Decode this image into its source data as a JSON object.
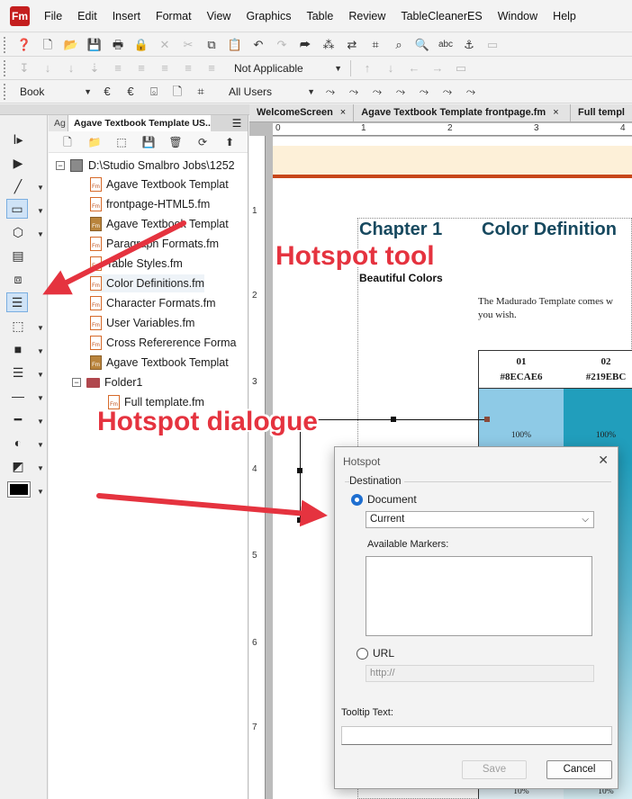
{
  "app": {
    "logo": "Fm",
    "menu": [
      "File",
      "Edit",
      "Insert",
      "Format",
      "View",
      "Graphics",
      "Table",
      "Review",
      "TableCleanerES",
      "Window",
      "Help"
    ]
  },
  "toolbar": {
    "condition_combo": "Not Applicable",
    "book_combo": "Book",
    "users_combo": "All Users"
  },
  "book_panel": {
    "tab_small": "Ag",
    "tab_title": "Agave Textbook Template US...",
    "menu_icon": "hamburger-icon",
    "tree": [
      {
        "label": "D:\\Studio Smalbro Jobs\\1252",
        "type": "root"
      },
      {
        "label": "Agave Textbook Templat",
        "type": "file"
      },
      {
        "label": "frontpage-HTML5.fm",
        "type": "file"
      },
      {
        "label": "Agave Textbook Templat",
        "type": "book"
      },
      {
        "label": "Paragraph Formats.fm",
        "type": "file"
      },
      {
        "label": "Table Styles.fm",
        "type": "file"
      },
      {
        "label": "Color Definitions.fm",
        "type": "file"
      },
      {
        "label": "Character Formats.fm",
        "type": "file"
      },
      {
        "label": "User Variables.fm",
        "type": "file"
      },
      {
        "label": "Cross Refererence Forma",
        "type": "file"
      },
      {
        "label": "Agave Textbook Templat",
        "type": "book"
      },
      {
        "label": "Folder1",
        "type": "folder"
      },
      {
        "label": "Full template.fm",
        "type": "file"
      }
    ]
  },
  "doc_tabs": [
    {
      "label": "WelcomeScreen",
      "close": "×"
    },
    {
      "label": "Agave Textbook Template frontpage.fm",
      "close": "×"
    },
    {
      "label": "Full templ",
      "close": ""
    }
  ],
  "ruler": {
    "h": [
      "0",
      "1",
      "2",
      "3",
      "4"
    ],
    "v": [
      "1",
      "2",
      "3",
      "4",
      "5",
      "6",
      "7"
    ]
  },
  "document": {
    "chapter": "Chapter 1",
    "chapter_title": "Color Definition",
    "subhead": "Beautiful Colors",
    "body_line1": "The Madurado Template comes w",
    "body_line2": "you wish.",
    "color_columns": [
      {
        "num": "01",
        "hex": "#8ECAE6",
        "pct_top": "100%",
        "pct_bottom": "10%",
        "color": "#8ECAE6"
      },
      {
        "num": "02",
        "hex": "#219EBC",
        "pct_top": "100%",
        "pct_bottom": "10%",
        "color": "#219EBC"
      }
    ]
  },
  "dialog": {
    "title": "Hotspot",
    "close": "✕",
    "destination_legend": "Destination",
    "document_label": "Document",
    "document_select": "Current",
    "markers_label": "Available Markers:",
    "url_label": "URL",
    "url_placeholder": "http://",
    "tooltip_label": "Tooltip Text:",
    "save": "Save",
    "cancel": "Cancel"
  },
  "annotations": {
    "hotspot_tool": "Hotspot tool",
    "hotspot_dialogue": "Hotspot dialogue"
  },
  "colors": {
    "accent_red": "#e5333f",
    "chapter_blue": "#17495f",
    "radio_blue": "#1f6fd0"
  }
}
